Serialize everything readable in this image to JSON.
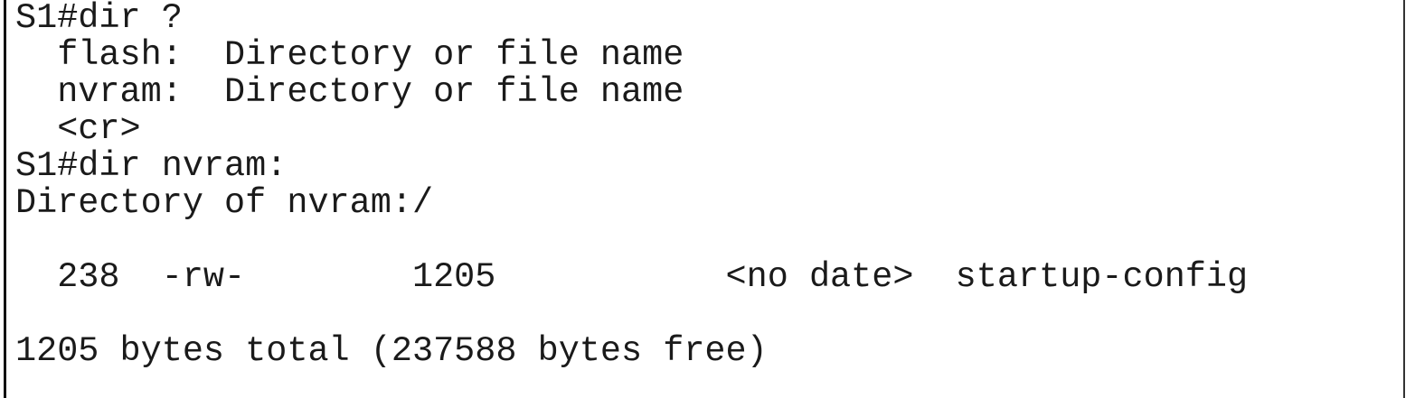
{
  "terminal": {
    "lines": [
      "S1#dir ?",
      "  flash:  Directory or file name",
      "  nvram:  Directory or file name",
      "  <cr>",
      "S1#dir nvram:",
      "Directory of nvram:/",
      "  238  -rw-        1205           <no date>  startup-config",
      "1205 bytes total (237588 bytes free)"
    ]
  }
}
